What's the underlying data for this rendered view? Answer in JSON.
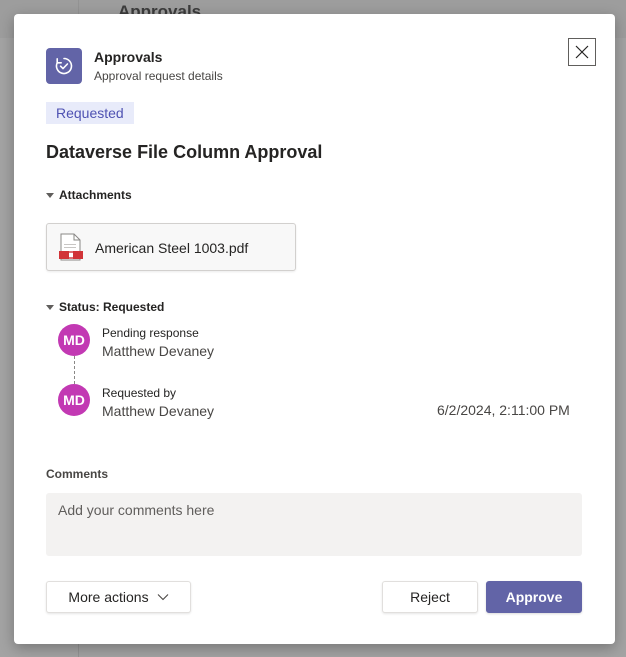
{
  "background": {
    "title": "Approvals"
  },
  "header": {
    "app_name": "Approvals",
    "subtitle": "Approval request details",
    "icon": "approvals-icon",
    "accent_color": "#6264a7"
  },
  "status_badge": "Requested",
  "title": "Dataverse File Column Approval",
  "attachments": {
    "label": "Attachments",
    "items": [
      {
        "name": "American Steel 1003.pdf",
        "icon": "pdf-file-icon"
      }
    ]
  },
  "status": {
    "label": "Status: Requested",
    "steps": [
      {
        "initials": "MD",
        "label": "Pending response",
        "name": "Matthew Devaney",
        "timestamp": ""
      },
      {
        "initials": "MD",
        "label": "Requested by",
        "name": "Matthew Devaney",
        "timestamp": "6/2/2024, 2:11:00 PM"
      }
    ],
    "avatar_color": "#c239b3"
  },
  "comments": {
    "label": "Comments",
    "placeholder": "Add your comments here",
    "value": ""
  },
  "actions": {
    "more_label": "More actions",
    "reject_label": "Reject",
    "approve_label": "Approve"
  }
}
